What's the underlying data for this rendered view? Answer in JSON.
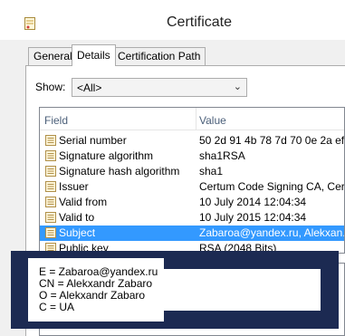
{
  "window": {
    "title": "Certificate",
    "icon": "certificate-icon"
  },
  "tabs": [
    {
      "label": "General",
      "active": false
    },
    {
      "label": "Details",
      "active": true
    },
    {
      "label": "Certification Path",
      "active": false
    }
  ],
  "show": {
    "label": "Show:",
    "selected": "<All>"
  },
  "list": {
    "columns": {
      "field": "Field",
      "value": "Value"
    },
    "rows": [
      {
        "field": "Serial number",
        "value": "50 2d 91 4b 78 7d 70 0e 2a ef..."
      },
      {
        "field": "Signature algorithm",
        "value": "sha1RSA"
      },
      {
        "field": "Signature hash algorithm",
        "value": "sha1"
      },
      {
        "field": "Issuer",
        "value": "Certum Code Signing CA, Cert..."
      },
      {
        "field": "Valid from",
        "value": "10 July 2014 12:04:34"
      },
      {
        "field": "Valid to",
        "value": "10 July 2015 12:04:34"
      },
      {
        "field": "Subject",
        "value": "Zabaroa@yandex.ru, Alekxan...",
        "selected": true
      },
      {
        "field": "Public key",
        "value": "RSA (2048 Bits)"
      }
    ]
  },
  "detail": {
    "lines": [
      "E = Zabaroa@yandex.ru",
      "CN = Alekxandr Zabaro",
      "O = Alekxandr Zabaro",
      "C = UA"
    ]
  },
  "colors": {
    "selection": "#3399ff",
    "overlay_frame": "#1c2a52",
    "header_text": "#4c607a"
  }
}
